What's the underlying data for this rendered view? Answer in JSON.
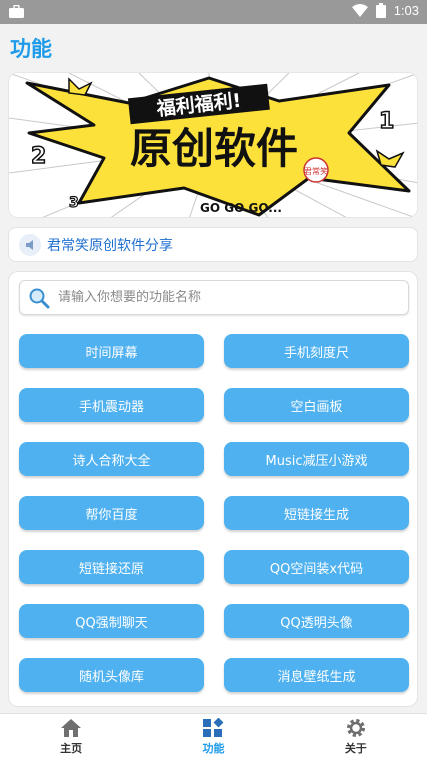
{
  "status_bar": {
    "time": "1:03"
  },
  "header": {
    "title": "功能"
  },
  "banner": {
    "top_text": "福利福利!",
    "main_text": "原创软件",
    "bottom_text": "GO GO GO...",
    "stamp_text": "君常笑",
    "numbers": [
      "1",
      "2",
      "3"
    ]
  },
  "notice": {
    "text": "君常笑原创软件分享"
  },
  "search": {
    "placeholder": "请输入你想要的功能名称",
    "value": ""
  },
  "functions": [
    {
      "label": "时间屏幕"
    },
    {
      "label": "手机刻度尺"
    },
    {
      "label": "手机震动器"
    },
    {
      "label": "空白画板"
    },
    {
      "label": "诗人合称大全"
    },
    {
      "label": "Music减压小游戏"
    },
    {
      "label": "帮你百度"
    },
    {
      "label": "短链接生成"
    },
    {
      "label": "短链接还原"
    },
    {
      "label": "QQ空间装x代码"
    },
    {
      "label": "QQ强制聊天"
    },
    {
      "label": "QQ透明头像"
    },
    {
      "label": "随机头像库"
    },
    {
      "label": "消息壁纸生成"
    }
  ],
  "bottom_nav": {
    "items": [
      {
        "label": "主页",
        "icon": "home-icon"
      },
      {
        "label": "功能",
        "icon": "apps-icon"
      },
      {
        "label": "关于",
        "icon": "gear-icon"
      }
    ]
  },
  "colors": {
    "accent": "#1f9bea",
    "button": "#4fb1ef",
    "status_bar": "#999999"
  }
}
